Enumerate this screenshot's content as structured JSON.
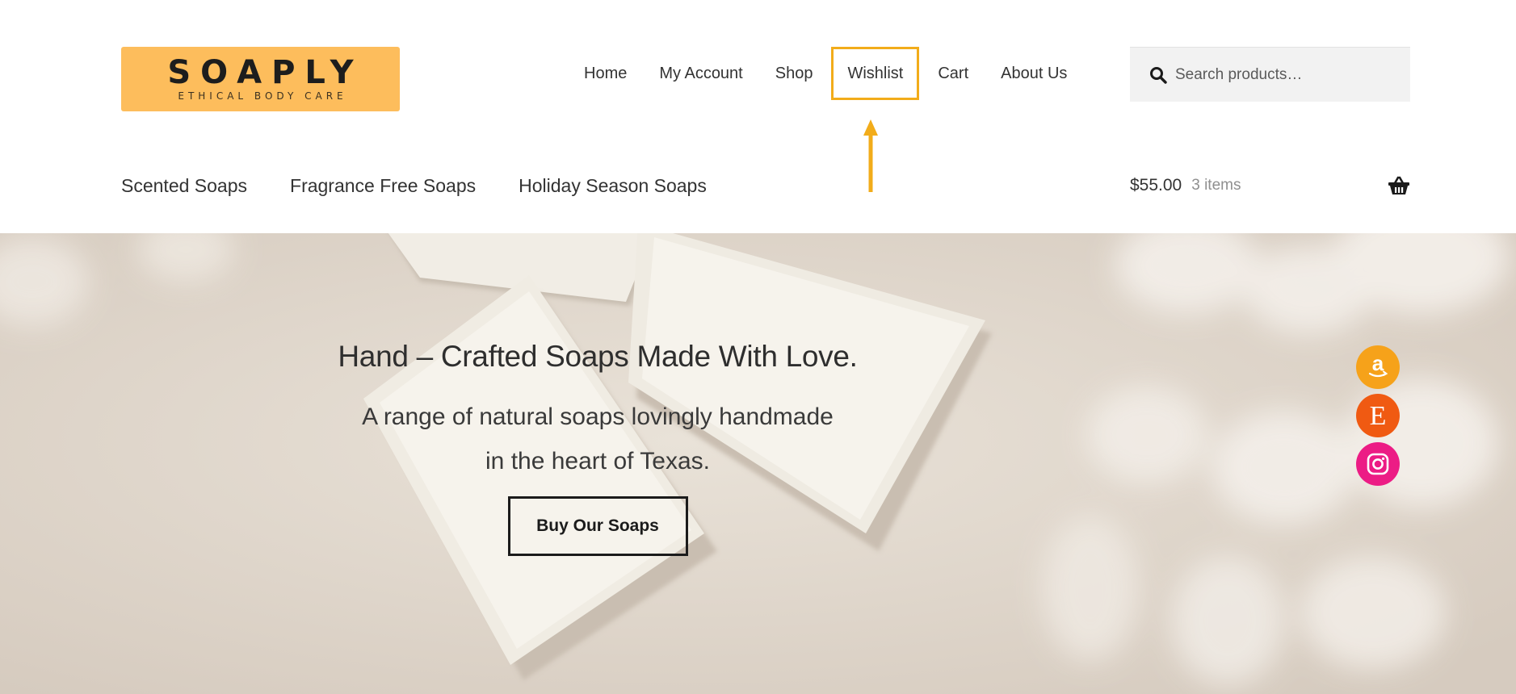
{
  "brand": {
    "name": "SOAPLY",
    "tagline": "ETHICAL BODY CARE",
    "color": "#fdbd5c"
  },
  "primary_nav": [
    "Home",
    "My Account",
    "Shop",
    "Wishlist",
    "Cart",
    "About Us"
  ],
  "highlighted_nav_item": "Wishlist",
  "highlight_color": "#f2ac1a",
  "search": {
    "placeholder": "Search products…",
    "value": "",
    "icon": "search-icon"
  },
  "secondary_nav": [
    "Scented Soaps",
    "Fragrance Free Soaps",
    "Holiday Season Soaps"
  ],
  "cart": {
    "amount": "$55.00",
    "count": "3 items",
    "icon": "basket-icon"
  },
  "hero": {
    "title": "Hand – Crafted Soaps Made With Love.",
    "text_line1": "A range of natural soaps lovingly handmade",
    "text_line2": "in the heart of Texas.",
    "button": "Buy Our Soaps"
  },
  "social": [
    {
      "name": "amazon-icon",
      "glyph": "a",
      "color": "#f6a21a"
    },
    {
      "name": "etsy-icon",
      "glyph": "E",
      "color": "#f05a12"
    },
    {
      "name": "instagram-icon",
      "glyph": "",
      "color": "#ec1c85"
    }
  ]
}
